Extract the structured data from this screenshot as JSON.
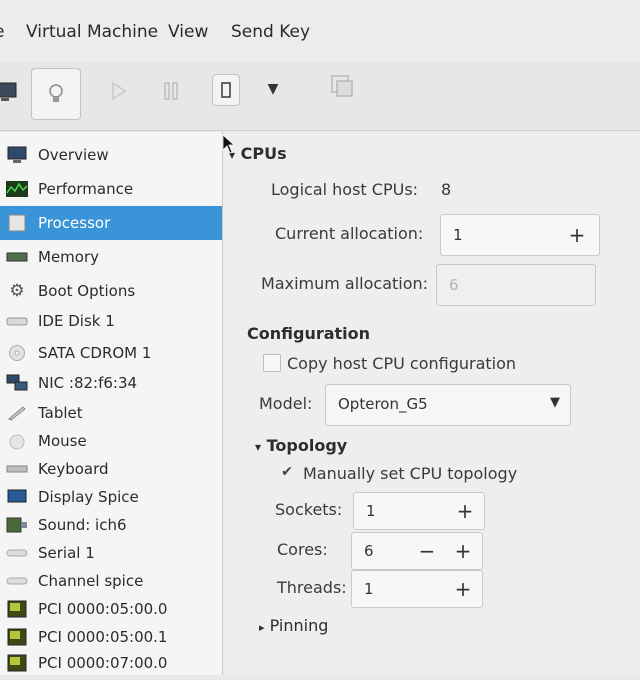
{
  "menubar": {
    "items": [
      "e",
      "Virtual Machine",
      "View",
      "Send Key"
    ]
  },
  "toolbar": {
    "icons": [
      "monitor-icon",
      "lightbulb-icon",
      "play-icon",
      "pause-icon",
      "power-icon",
      "dropdown-arrow-icon",
      "screenshot-icon"
    ]
  },
  "sidebar": {
    "items": [
      {
        "label": "Overview",
        "icon": "monitor-icon"
      },
      {
        "label": "Performance",
        "icon": "performance-graph-icon"
      },
      {
        "label": "Processor",
        "icon": "processor-icon"
      },
      {
        "label": "Memory",
        "icon": "memory-icon"
      },
      {
        "label": "Boot Options",
        "icon": "gear-icon"
      },
      {
        "label": "IDE Disk 1",
        "icon": "disk-icon"
      },
      {
        "label": "SATA CDROM 1",
        "icon": "cdrom-icon"
      },
      {
        "label": "NIC :82:f6:34",
        "icon": "network-icon"
      },
      {
        "label": "Tablet",
        "icon": "tablet-icon"
      },
      {
        "label": "Mouse",
        "icon": "mouse-icon"
      },
      {
        "label": "Keyboard",
        "icon": "keyboard-icon"
      },
      {
        "label": "Display Spice",
        "icon": "display-icon"
      },
      {
        "label": "Sound: ich6",
        "icon": "sound-icon"
      },
      {
        "label": "Serial 1",
        "icon": "serial-icon"
      },
      {
        "label": "Channel spice",
        "icon": "channel-icon"
      },
      {
        "label": "PCI 0000:05:00.0",
        "icon": "pci-card-icon"
      },
      {
        "label": "PCI 0000:05:00.1",
        "icon": "pci-card-icon"
      },
      {
        "label": "PCI 0000:07:00.0",
        "icon": "pci-card-icon"
      }
    ],
    "selected": "Processor"
  },
  "cpus": {
    "heading": "CPUs",
    "logical_label": "Logical host CPUs:",
    "logical_value": "8",
    "current_label": "Current allocation:",
    "current_value": "1",
    "max_label": "Maximum allocation:",
    "max_value": "6",
    "plus": "+",
    "minus": "−"
  },
  "configuration": {
    "heading": "Configuration",
    "copy_label": "Copy host CPU configuration",
    "copy_checked": false,
    "model_label": "Model:",
    "model_value": "Opteron_G5"
  },
  "topology": {
    "heading": "Topology",
    "manual_label": "Manually set CPU topology",
    "manual_checked": true,
    "check_glyph": "✔",
    "sockets_label": "Sockets:",
    "sockets_value": "1",
    "cores_label": "Cores:",
    "cores_value": "6",
    "threads_label": "Threads:",
    "threads_value": "1"
  },
  "pinning": {
    "heading": "Pinning"
  }
}
